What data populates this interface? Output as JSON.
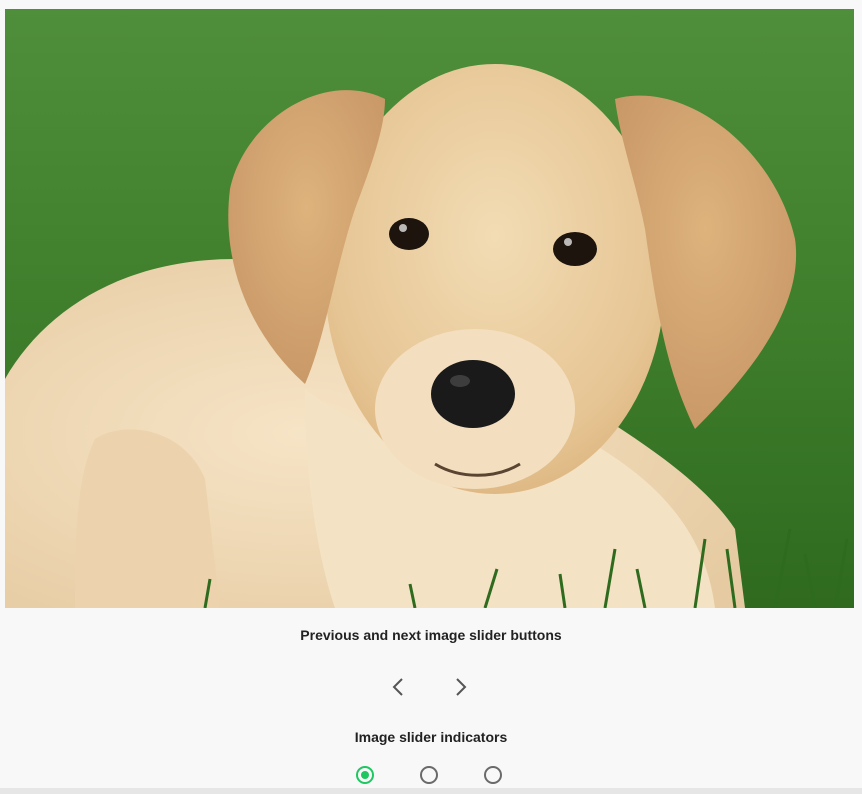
{
  "slider": {
    "current_slide_image": "labrador-puppy-photo",
    "slide_count": 3,
    "active_index": 0
  },
  "sections": {
    "buttons_label": "Previous and next image slider buttons",
    "indicators_label": "Image slider indicators"
  },
  "icons": {
    "prev": "chevron-left-icon",
    "next": "chevron-right-icon"
  },
  "colors": {
    "active_indicator": "#1ec762",
    "inactive_indicator": "#6a6a6a",
    "background": "#f8f8f8"
  }
}
